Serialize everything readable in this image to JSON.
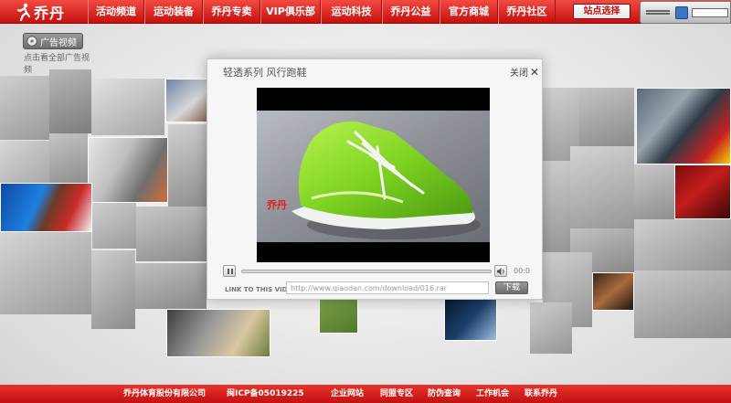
{
  "brand": {
    "logo_text": "乔丹"
  },
  "nav": {
    "items": [
      {
        "label": "活动频道"
      },
      {
        "label": "运动装备"
      },
      {
        "label": "乔丹专卖"
      },
      {
        "label": "VIP俱乐部"
      },
      {
        "label": "运动科技"
      },
      {
        "label": "乔丹公益"
      },
      {
        "label": "官方商城"
      },
      {
        "label": "乔丹社区"
      }
    ],
    "visit_button": "站点选择"
  },
  "ad": {
    "button_label": "广告视频",
    "caption": "点击看全部广告视频"
  },
  "modal": {
    "title": "轻透系列 风行跑鞋",
    "close_label": "关闭",
    "video_logo": "乔丹",
    "time": "00:0",
    "link_label": "LINK TO THIS VIDEO:",
    "link_value": "http://www.qiaodan.com/download/016.rar",
    "download_label": "下载"
  },
  "footer": {
    "company": "乔丹体育股份有限公司",
    "icp": "闽ICP备05019225",
    "links": [
      {
        "label": "企业网站"
      },
      {
        "label": "同盟专区"
      },
      {
        "label": "防伪查询"
      },
      {
        "label": "工作机会"
      },
      {
        "label": "联系乔丹"
      }
    ]
  },
  "colors": {
    "brand_red": "#d41c1c",
    "shoe_green": "#7ed321"
  }
}
